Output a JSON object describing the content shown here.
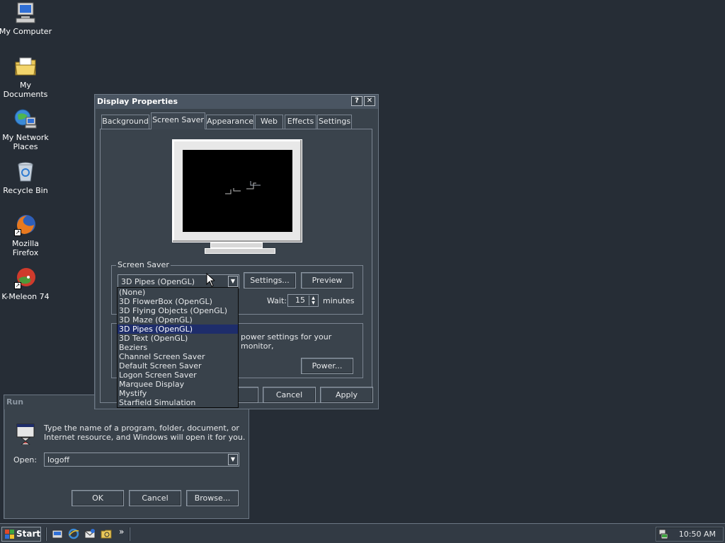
{
  "desktop": {
    "icons": [
      {
        "label": "My Computer",
        "icon": "my-computer-icon"
      },
      {
        "label": "My Documents",
        "icon": "my-documents-icon"
      },
      {
        "label": "My Network Places",
        "icon": "network-places-icon"
      },
      {
        "label": "Recycle Bin",
        "icon": "recycle-bin-icon"
      },
      {
        "label": "Mozilla Firefox",
        "icon": "firefox-icon"
      },
      {
        "label": "K-Meleon 74",
        "icon": "k-meleon-icon"
      }
    ]
  },
  "display_properties": {
    "title": "Display Properties",
    "help_glyph": "?",
    "close_glyph": "✕",
    "tabs": [
      {
        "label": "Background"
      },
      {
        "label": "Screen Saver"
      },
      {
        "label": "Appearance"
      },
      {
        "label": "Web"
      },
      {
        "label": "Effects"
      },
      {
        "label": "Settings"
      }
    ],
    "screensaver_group_label": "Screen Saver",
    "screensaver_selected": "3D Pipes (OpenGL)",
    "settings_button": "Settings...",
    "preview_button": "Preview",
    "wait_label": "Wait:",
    "wait_value": "15",
    "minutes_label": "minutes",
    "power_text": "power settings for your monitor,",
    "power_button": "Power...",
    "cancel_button": "Cancel",
    "apply_button": "Apply",
    "dropdown_options": [
      "(None)",
      "3D FlowerBox (OpenGL)",
      "3D Flying Objects (OpenGL)",
      "3D Maze (OpenGL)",
      "3D Pipes (OpenGL)",
      "3D Text (OpenGL)",
      "Beziers",
      "Channel Screen Saver",
      "Default Screen Saver",
      "Logon Screen Saver",
      "Marquee Display",
      "Mystify",
      "Starfield Simulation"
    ],
    "dropdown_selected_index": 4
  },
  "run_dialog": {
    "title": "Run",
    "description_line1": "Type the name of a program, folder, document, or",
    "description_line2": "Internet resource, and Windows will open it for you.",
    "open_label": "Open:",
    "open_value": "logoff",
    "ok_button": "OK",
    "cancel_button": "Cancel",
    "browse_button": "Browse..."
  },
  "taskbar": {
    "start_label": "Start",
    "quick_launch_more": "»",
    "clock": "10:50 AM"
  }
}
